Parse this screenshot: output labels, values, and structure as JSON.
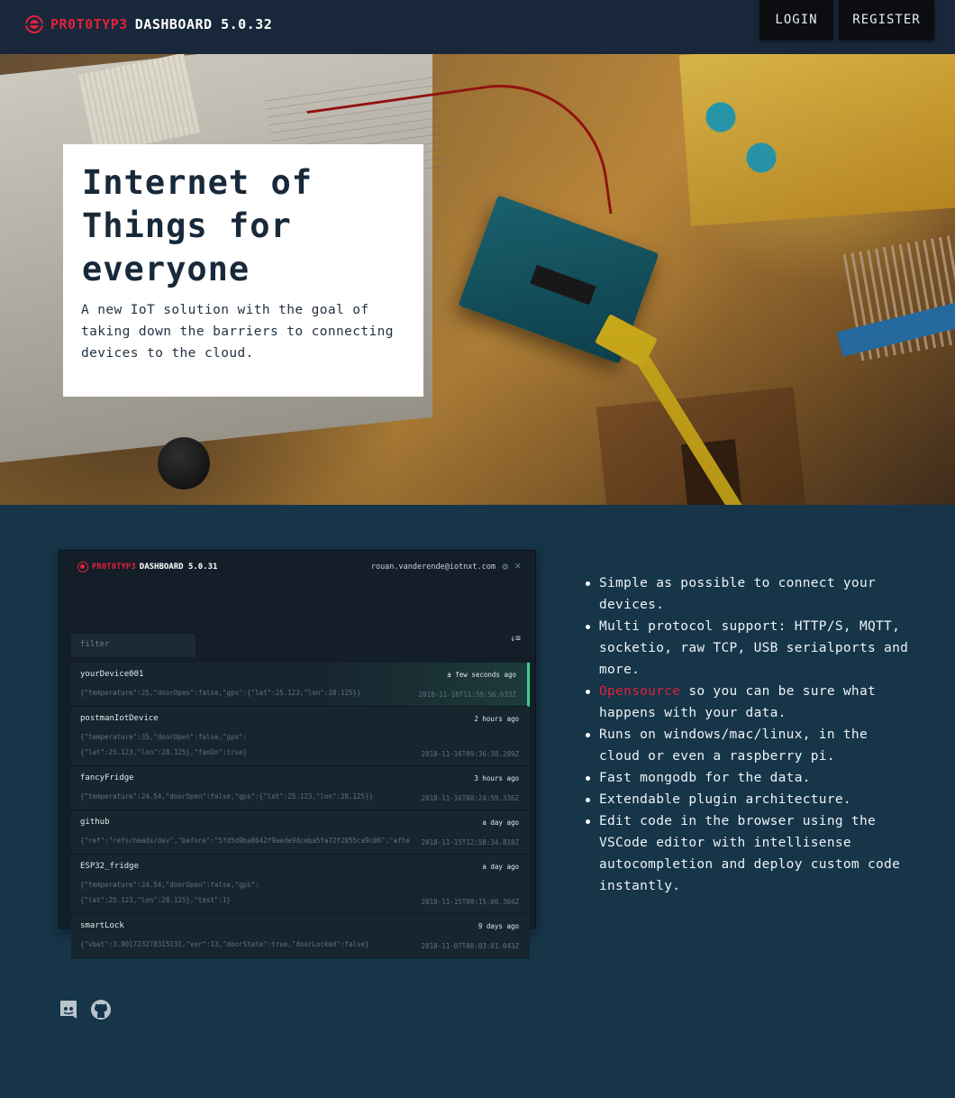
{
  "nav": {
    "brand_name": "PR0T0TYP3",
    "brand_version": "DASHBOARD 5.0.32",
    "login_label": "LOGIN",
    "register_label": "REGISTER"
  },
  "hero": {
    "title": "Internet of Things for everyone",
    "subtitle": "A new IoT solution with the goal of taking down the barriers to connecting devices to the cloud."
  },
  "preview": {
    "brand_name": "PR0T0TYP3",
    "brand_version": "DASHBOARD 5.0.31",
    "user_email": "rouan.vanderende@iotnxt.com",
    "filter_placeholder": "filter",
    "sort_icon": "↓≡",
    "devices": [
      {
        "name": "yourDevice001",
        "time": "a few seconds ago",
        "data": "{\"temperature\":25,\"doorOpen\":false,\"gps\":{\"lat\":25.123,\"lon\":28.125}}",
        "stamp": "2018-11-16T11:59:56.633Z",
        "active": true
      },
      {
        "name": "postmanIotDevice",
        "time": "2 hours ago",
        "data": "{\"temperature\":35,\"doorOpen\":false,\"gps\":\n{\"lat\":25.123,\"lon\":28.125},\"fanOn\":true}",
        "stamp": "2018-11-16T09:36:38.209Z",
        "active": false
      },
      {
        "name": "fancyFridge",
        "time": "3 hours ago",
        "data": "{\"temperature\":24.54,\"doorOpen\":false,\"gps\":{\"lat\":25.123,\"lon\":28.125}}",
        "stamp": "2018-11-16T08:24:59.336Z",
        "active": false
      },
      {
        "name": "github",
        "time": "a day ago",
        "data": "{\"ref\":\"refs/heads/dev\",\"before\":\"5fd5d9ba8642f9aede9dceba5fa72f2055ca9c06\",\"afte",
        "stamp": "2018-11-15T12:58:34.818Z",
        "active": false
      },
      {
        "name": "ESP32_fridge",
        "time": "a day ago",
        "data": "{\"temperature\":24.54,\"doorOpen\":false,\"gps\":\n{\"lat\":25.123,\"lon\":28.125},\"test\":1}",
        "stamp": "2018-11-15T09:15:06.304Z",
        "active": false
      },
      {
        "name": "smartLock",
        "time": "9 days ago",
        "data": "{\"vbat\":3.901723278315131,\"ver\":13,\"doorState\":true,\"doorLocked\":false}",
        "stamp": "2018-11-07T08:03:01.043Z",
        "active": false
      }
    ]
  },
  "features": {
    "items": [
      "Simple as possible to connect your devices.",
      "Multi protocol support: HTTP/S, MQTT, socketio, raw TCP, USB serialports and more.",
      "",
      "Runs on windows/mac/linux, in the cloud or even a raspberry pi.",
      "Fast mongodb for the data.",
      "Extendable plugin architecture.",
      "Edit code in the browser using the VSCode editor with intellisense autocompletion and deploy custom code instantly."
    ],
    "opensource_link": "Opensource",
    "opensource_rest": " so you can be sure what happens with your data."
  },
  "footer": {
    "icons": [
      "discord-icon",
      "github-icon"
    ]
  },
  "colors": {
    "accent": "#e0213a",
    "nav_bg": "#18283a",
    "page_bg": "#163549",
    "active_row": "#3bd18a"
  }
}
